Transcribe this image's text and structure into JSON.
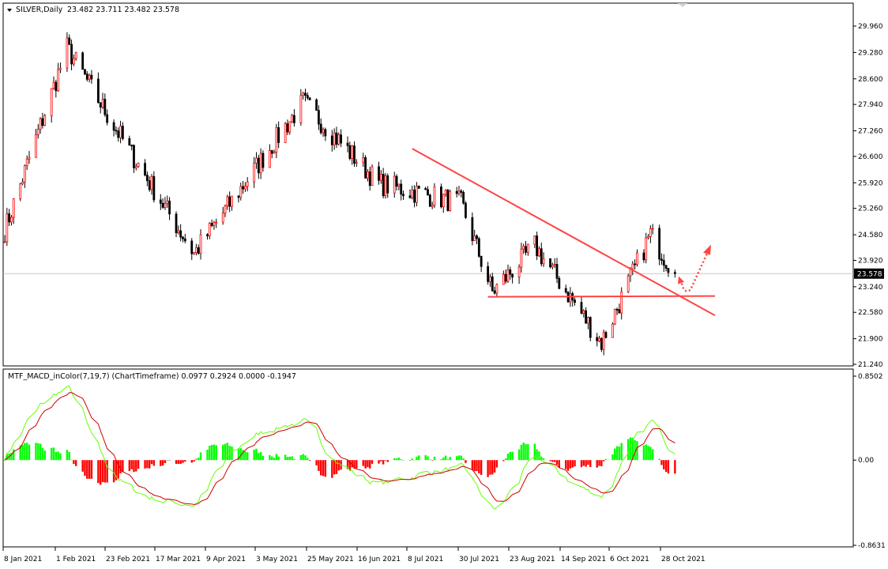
{
  "chart_data": [
    {
      "type": "candlestick",
      "header": {
        "symbol": "SILVER,Daily",
        "ohlc": "23.482 23.711 23.482 23.578"
      },
      "last_price": 23.578,
      "last_price_label": "23.578",
      "y_ticks": [
        "29.960",
        "29.280",
        "28.600",
        "27.940",
        "27.260",
        "26.600",
        "25.920",
        "25.260",
        "24.580",
        "23.920",
        "23.240",
        "22.580",
        "21.900",
        "21.240"
      ],
      "ylim": [
        21.24,
        29.96
      ],
      "up_color": "#ff0000",
      "down_color": "#000000",
      "key_points": [
        {
          "date": "2021-01-04",
          "close": 24.7
        },
        {
          "date": "2021-02-01",
          "close": 29.4
        },
        {
          "date": "2021-02-23",
          "close": 27.3
        },
        {
          "date": "2021-03-30",
          "close": 24.1
        },
        {
          "date": "2021-05-18",
          "close": 28.0
        },
        {
          "date": "2021-06-21",
          "close": 25.9
        },
        {
          "date": "2021-07-28",
          "close": 25.4
        },
        {
          "date": "2021-08-11",
          "close": 23.1
        },
        {
          "date": "2021-08-30",
          "close": 24.3
        },
        {
          "date": "2021-09-29",
          "close": 21.8
        },
        {
          "date": "2021-10-21",
          "close": 24.6
        },
        {
          "date": "2021-11-01",
          "close": 23.58
        }
      ],
      "annotations": [
        {
          "kind": "trendline",
          "color": "#ff4444",
          "from": {
            "date": "2021-07-06",
            "price": 26.8
          },
          "to": {
            "date": "2021-11-03",
            "price": 22.5
          }
        },
        {
          "kind": "horizontal",
          "color": "#ff4444",
          "from": {
            "date": "2021-08-09",
            "price": 22.98
          },
          "to": {
            "date": "2021-11-03",
            "price": 23.0
          }
        },
        {
          "kind": "dotted-arrow",
          "color": "#ff4444",
          "direction": "up"
        }
      ]
    },
    {
      "type": "histogram+lines",
      "header": "MTF_MACD_inColor(7,19,7) (ChartTimeframe) 0.0977 0.2924 0.0000 -0.1947",
      "y_ticks": [
        "0.8502",
        "0.00",
        "-0.8631"
      ],
      "ylim": [
        -0.8631,
        0.8502
      ],
      "positive_color": "#00ff00",
      "negative_color": "#ff0000",
      "signal_color": "#cc0000",
      "macd_color": "#66ff00"
    }
  ],
  "x_ticks": [
    "8 Jan 2021",
    "1 Feb 2021",
    "23 Feb 2021",
    "17 Mar 2021",
    "9 Apr 2021",
    "3 May 2021",
    "25 May 2021",
    "16 Jun 2021",
    "8 Jul 2021",
    "30 Jul 2021",
    "23 Aug 2021",
    "14 Sep 2021",
    "6 Oct 2021",
    "28 Oct 2021"
  ],
  "x_range": [
    "2021-01-04",
    "2021-11-03"
  ]
}
